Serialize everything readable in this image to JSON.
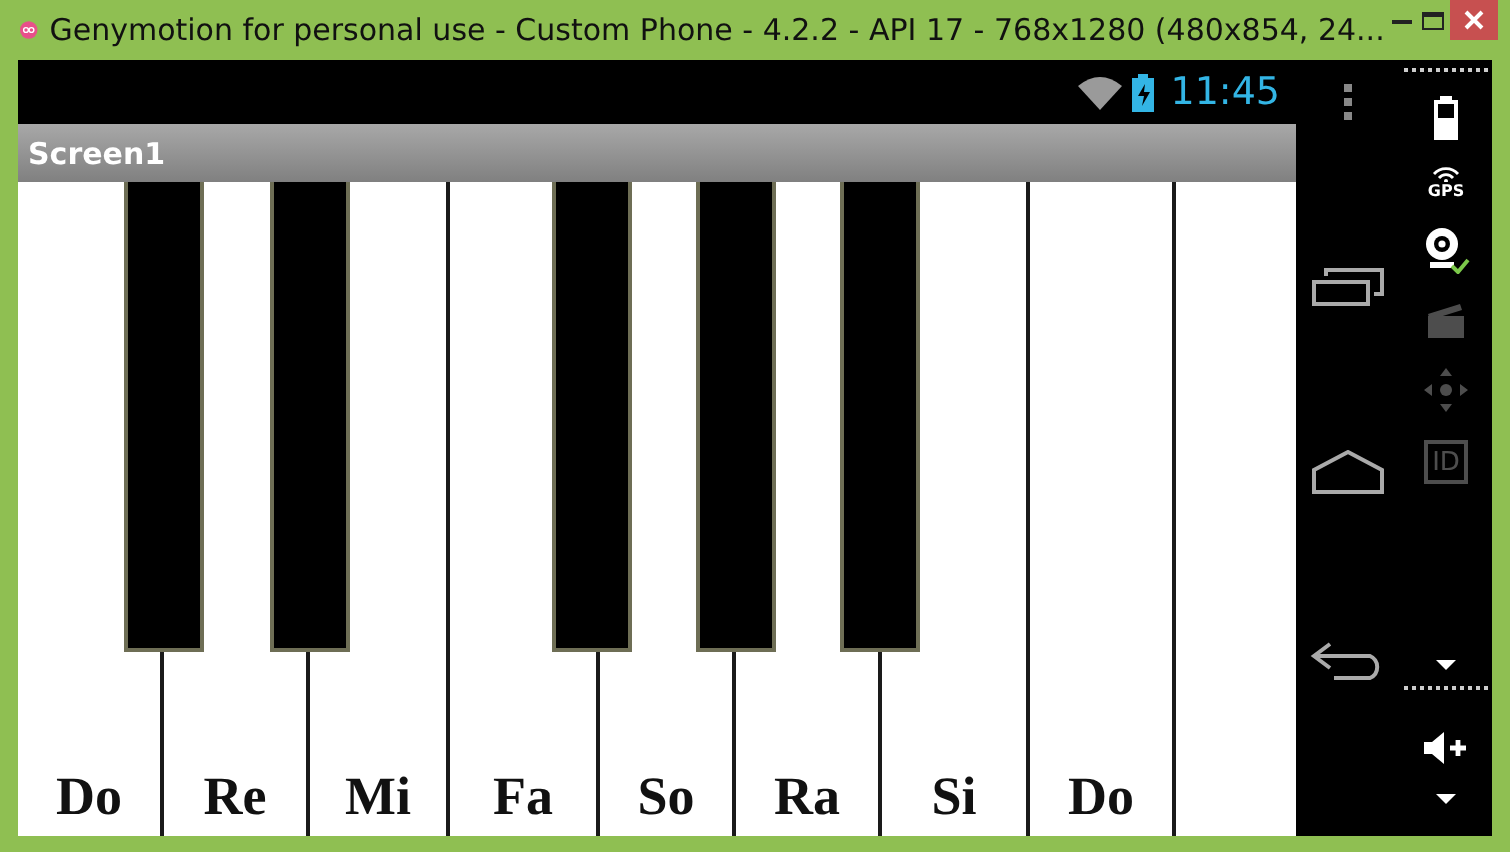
{
  "window": {
    "title": "Genymotion for personal use - Custom Phone - 4.2.2 - API 17 - 768x1280 (480x854, 24..."
  },
  "status_bar": {
    "time": "11:45"
  },
  "action_bar": {
    "title": "Screen1"
  },
  "keyboard": {
    "white_keys": [
      {
        "label": "Do"
      },
      {
        "label": "Re"
      },
      {
        "label": "Mi"
      },
      {
        "label": "Fa"
      },
      {
        "label": "So"
      },
      {
        "label": "Ra"
      },
      {
        "label": "Si"
      },
      {
        "label": "Do"
      }
    ]
  },
  "emulator_sidebar": {
    "items": [
      {
        "kind": "battery",
        "disabled": false
      },
      {
        "kind": "gps",
        "label": "GPS",
        "disabled": false
      },
      {
        "kind": "camera",
        "disabled": false
      },
      {
        "kind": "video",
        "disabled": true
      },
      {
        "kind": "dpad",
        "disabled": true
      },
      {
        "kind": "id",
        "label": "ID",
        "disabled": true
      }
    ]
  }
}
